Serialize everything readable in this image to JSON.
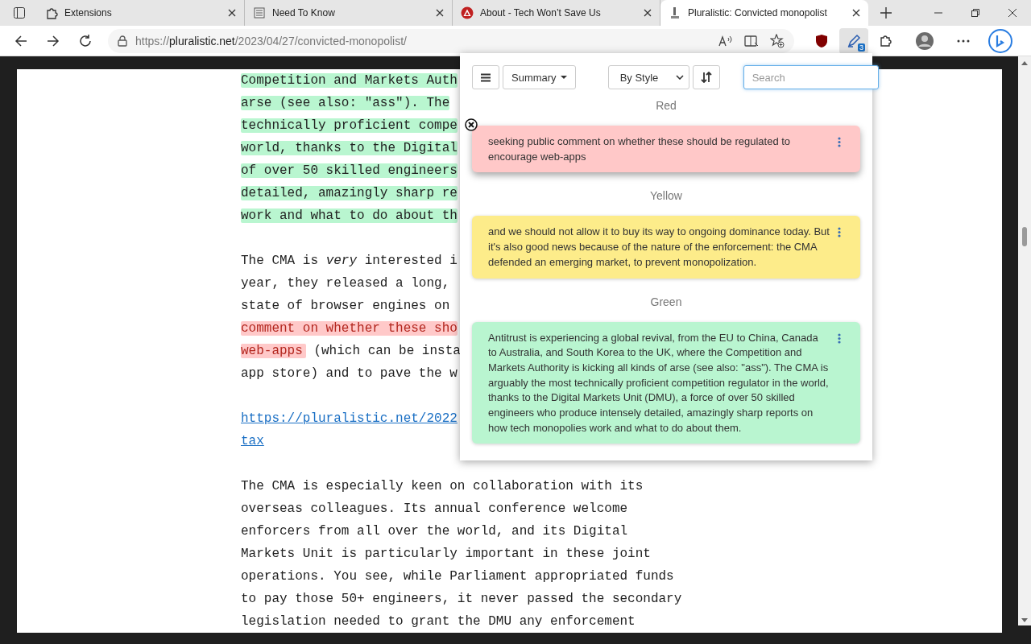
{
  "tabs": [
    {
      "title": "Extensions",
      "selected": false
    },
    {
      "title": "Need To Know",
      "selected": false
    },
    {
      "title": "About - Tech Won’t Save Us",
      "selected": false
    },
    {
      "title": "Pluralistic: Convicted monopolist",
      "selected": true
    }
  ],
  "address": {
    "scheme": "https://",
    "host": "pluralistic.net",
    "path": "/2023/04/27/convicted-monopolist/"
  },
  "extension_badge": "3",
  "article": [
    {
      "kind": "text",
      "lines": [
        [
          {
            "text": "Competition and Markets Auth",
            "color": "#b9f6d0"
          }
        ],
        [
          {
            "text": "arse (see also: \"ass\"). The",
            "color": "#b9f6d0"
          }
        ],
        [
          {
            "text": "technically proficient compe",
            "color": "#b9f6d0"
          }
        ],
        [
          {
            "text": "world, thanks to the Digital",
            "color": "#b9f6d0"
          }
        ],
        [
          {
            "text": "of over 50 skilled engineers",
            "color": "#b9f6d0"
          }
        ],
        [
          {
            "text": "detailed, amazingly sharp re",
            "color": "#b9f6d0"
          }
        ],
        [
          {
            "text": "work and what to do about th",
            "color": "#b9f6d0"
          }
        ]
      ]
    },
    {
      "kind": "text",
      "lines": [
        [
          {
            "text": "The CMA is *very* interested i"
          }
        ],
        [
          {
            "text": "year, they released a long,"
          }
        ],
        [
          {
            "text": "state of browser engines on"
          }
        ],
        [
          {
            "text": "comment on whether these sho",
            "color": "#ffc9c9"
          }
        ],
        [
          {
            "text": "web-apps",
            "color": "#ffc9c9"
          },
          {
            "text": " (which can be insta"
          }
        ],
        [
          {
            "text": "app store) and to pave the w"
          }
        ]
      ]
    },
    {
      "kind": "link",
      "lines": [
        [
          {
            "text": "https://pluralistic.net/2022"
          }
        ],
        [
          {
            "text": "tax"
          }
        ]
      ]
    },
    {
      "kind": "text",
      "lines": [
        [
          {
            "text": "The CMA is especially keen on collaboration with its"
          }
        ],
        [
          {
            "text": "overseas colleagues. Its annual conference welcome"
          }
        ],
        [
          {
            "text": "enforcers from all over the world, and its Digital"
          }
        ],
        [
          {
            "text": "Markets Unit is particularly important in these joint"
          }
        ],
        [
          {
            "text": "operations. You see, while Parliament appropriated funds"
          }
        ],
        [
          {
            "text": "to pay those 50+ engineers, it never passed the secondary"
          }
        ],
        [
          {
            "text": "legislation needed to grant the DMU any enforcement"
          }
        ]
      ]
    }
  ],
  "popup": {
    "view_button": "Summary",
    "sort_select": "By Style",
    "search": {
      "placeholder": "Search"
    },
    "groups": [
      {
        "label": "Red",
        "cards": [
          {
            "text": "seeking public comment on whether these should be regulated to encourage web-apps",
            "color": "#ffc8c8",
            "hovered": true
          }
        ]
      },
      {
        "label": "Yellow",
        "cards": [
          {
            "text": "and we should not allow it to buy its way to ongoing dominance today. But it's also good news because of the nature of the enforcement: the CMA defended an emerging market, to prevent monopolization.",
            "color": "#fdec8a",
            "hovered": false
          }
        ]
      },
      {
        "label": "Green",
        "cards": [
          {
            "text": "Antitrust is experiencing a global revival, from the EU to China, Canada to Australia, and South Korea to the UK, where the Competition and Markets Authority is kicking all kinds of arse (see also: \"ass\"). The CMA is arguably the most technically proficient competition regulator in the world, thanks to the Digital Markets Unit (DMU), a force of over 50 skilled engineers who produce intensely detailed, amazingly sharp reports on how tech monopolies work and what to do about them.",
            "color": "#b9f5d0",
            "hovered": false
          }
        ]
      }
    ]
  }
}
